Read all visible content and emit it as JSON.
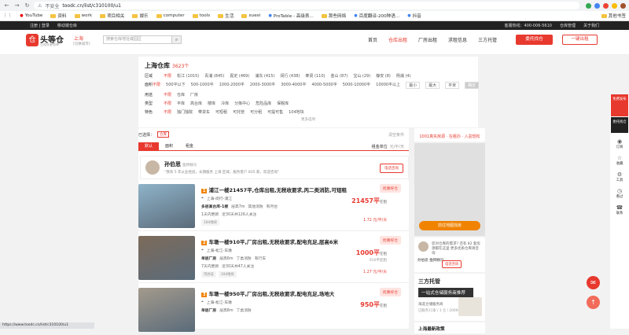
{
  "browser": {
    "insecure": "不安全",
    "url": "toodc.cn/list/c310100/u1"
  },
  "bookmarks": [
    {
      "label": "YouTube",
      "icon": "youtube-icon",
      "folder": false
    },
    {
      "label": "资料",
      "folder": true
    },
    {
      "label": "work",
      "folder": true
    },
    {
      "label": "项目相关",
      "folder": true
    },
    {
      "label": "娱乐",
      "folder": true
    },
    {
      "label": "computer",
      "folder": true
    },
    {
      "label": "tools",
      "folder": true
    },
    {
      "label": "生活",
      "folder": true
    },
    {
      "label": "xuexi",
      "folder": true
    },
    {
      "label": "ProTable - 高级表...",
      "folder": false
    },
    {
      "label": "那些网络",
      "folder": true
    },
    {
      "label": "百度翻译-200种语...",
      "folder": false
    },
    {
      "label": "抖音",
      "folder": false
    }
  ],
  "bookmarks_other": "其他书签",
  "top": {
    "login": "注册 | 登录",
    "mobile": "移动端仓库",
    "phone": "客服热线：400-006-5610",
    "ops": "仓库管理",
    "about": "关于我们"
  },
  "header": {
    "logo_text": "头等仓",
    "logo_sub": "让租仓更简单",
    "city": "上海",
    "city_sub": "[切换城市]",
    "search_placeholder": "搜索仓库地址或园区",
    "nav": [
      "首页",
      "仓库出租",
      "厂房出租",
      "求租信息",
      "三方托管"
    ],
    "btn_find": "委托找仓",
    "btn_publish": "一键出租"
  },
  "filter": {
    "title": "上海仓库",
    "count": "3623个",
    "rows": [
      {
        "label": "区域",
        "opts": [
          "不限",
          "松江 (1015)",
          "青浦 (845)",
          "嘉定 (469)",
          "浦东 (415)",
          "闵行 (438)",
          "奉贤 (110)",
          "金山 (87)",
          "宝山 (29)",
          "静安 (8)",
          "杨浦 (4)"
        ]
      },
      {
        "label": "面积",
        "opts": [
          "不限",
          "500平以下",
          "500-1000平",
          "1000-2000平",
          "2000-3000平",
          "3000-4000平",
          "4000-5000平",
          "5000-10000平",
          "10000平以上"
        ]
      },
      {
        "label": "用途",
        "opts": [
          "不限",
          "仓库",
          "厂房"
        ]
      },
      {
        "label": "类型",
        "opts": [
          "不限",
          "平库",
          "高台库",
          "楼库",
          "冷库",
          "分拣中心",
          "危险品库",
          "保税库"
        ]
      },
      {
        "label": "特色",
        "opts": [
          "不限",
          "独门独院",
          "带货车",
          "可短租",
          "可托管",
          "可分租",
          "可提可售",
          "104地块"
        ]
      }
    ],
    "area_min": "最小",
    "area_max": "最大",
    "area_unit": "平米",
    "area_ok": "确定",
    "more": "更多选项"
  },
  "results": {
    "selected_label": "已选择：",
    "selected_tag": "仓库",
    "reset": "清空条件",
    "sorts": [
      "默认",
      "面积",
      "租金"
    ],
    "unit_label": "租金单位",
    "unit_value": "元/平/天",
    "agent": {
      "name": "孙伯思",
      "badge": "金牌顾问",
      "desc": "“我有 5 年从业经验，长期服务 上海 区域，服务客户 835 家，欢迎咨询”",
      "call": "电话咨询"
    },
    "listings": [
      {
        "no": "1",
        "title": "浦江一楼21457平,仓库出租,无税收要求,丙二类消防,可短租",
        "loc": "上海-闵行-浦江",
        "tag": "优质好仓",
        "info": [
          "多层高台库-1楼",
          "层高7m",
          "其他消防",
          "有月台"
        ],
        "time": "1天内更新",
        "views": "近30天共126人关注",
        "price": "21457平",
        "price_note": "在租",
        "sub": "",
        "unitp": "1.72 元/平/天",
        "tags": [
          "104地块"
        ],
        "thumb": "#8fb3c9"
      },
      {
        "no": "2",
        "title": "车墩一楼910平,厂房出租,无税收要求,配电充足,层高6米",
        "loc": "上海-松江-车墩",
        "tag": "优质好仓",
        "info": [
          "单层厂房",
          "层高6m",
          "丁类消防",
          "有行车"
        ],
        "time": "7天内更新",
        "views": "近30天共47人关注",
        "price": "1000平",
        "price_note": "在租",
        "sub": "910平起租",
        "unitp": "1.27 元/平/天",
        "tags": [
          "可办证",
          "104地块"
        ],
        "thumb": "#7d6b5a"
      },
      {
        "no": "3",
        "title": "车墩一楼950平,厂房出租,无税收要求,配电充足,场地大",
        "loc": "上海-松江-车墩",
        "tag": "优质好仓",
        "info": [
          "单层厂房",
          "层高8m",
          "丁类消防"
        ],
        "time": "",
        "views": "",
        "price": "950平",
        "price_note": "在租",
        "sub": "",
        "unitp": "",
        "tags": [],
        "thumb": "#a39a8c"
      }
    ]
  },
  "side": {
    "head": "1001真实房源 · 在租办 · 入驻轻松",
    "map_btn": "前往地图找房",
    "card_text": "您对仓库的需求? 还有 82 套房源都在这里 更多优质仓库请咨询",
    "card_name": "孙伯思",
    "card_badge": "金牌顾问",
    "card_call": "电话咨询",
    "ad_t1": "三方托管",
    "ad_t2": "一站式仓储服务商推荐",
    "ad_t3": "海选仓储服务商",
    "ad_t4": "已服务11家 / 1 仓 / 20000平",
    "latest": "上海最新政策"
  },
  "rail": {
    "hot": "免费发布",
    "hot2": "委托找仓",
    "items": [
      "订阅",
      "收藏",
      "工具",
      "看过",
      "联系"
    ]
  },
  "status": "https://www.toodc.cn/list/c310100/u1"
}
